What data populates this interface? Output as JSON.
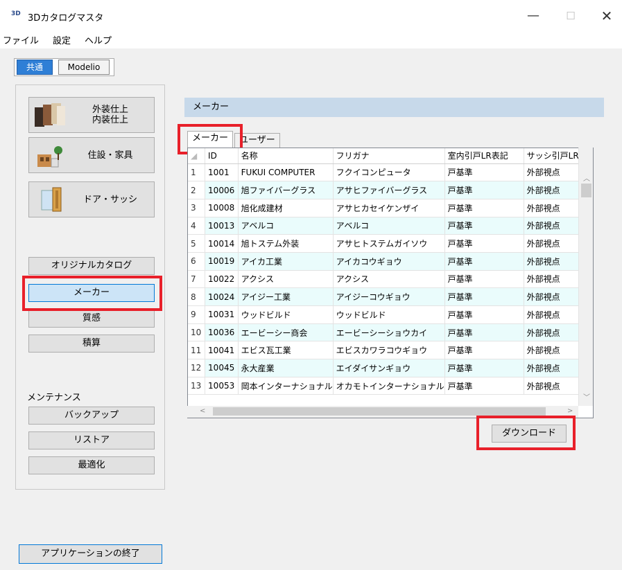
{
  "window": {
    "icon_text": "3D",
    "title": "3Dカタログマスタ",
    "min_glyph": "—",
    "max_glyph": "☐",
    "close_glyph": "✕"
  },
  "menu": [
    "ファイル",
    "設定",
    "ヘルプ"
  ],
  "top_tabs": [
    {
      "label": "共通",
      "active": true
    },
    {
      "label": "Modelio",
      "active": false
    }
  ],
  "left_panel": {
    "big_buttons": [
      {
        "line1": "外装仕上",
        "line2": "内装仕上"
      },
      {
        "line1": "住設・家具",
        "line2": ""
      },
      {
        "line1": "ドア・サッシ",
        "line2": ""
      }
    ],
    "catalog_buttons": [
      "オリジナルカタログ",
      "メーカー",
      "質感",
      "積算"
    ],
    "selected": "メーカー",
    "maintenance_label": "メンテナンス",
    "maintenance_buttons": [
      "バックアップ",
      "リストア",
      "最適化"
    ]
  },
  "content": {
    "header": "メーカー",
    "tabs": [
      "メーカー",
      "ユーザー"
    ],
    "active_tab": "メーカー",
    "columns": [
      "ID",
      "名称",
      "フリガナ",
      "室内引戸LR表記",
      "サッシ引戸LR表"
    ],
    "rows": [
      [
        "1",
        "1001",
        "FUKUI COMPUTER",
        "フクイコンピュータ",
        "戸基準",
        "外部視点"
      ],
      [
        "2",
        "10006",
        "旭ファイバーグラス",
        "アサヒファイバーグラス",
        "戸基準",
        "外部視点"
      ],
      [
        "3",
        "10008",
        "旭化成建材",
        "アサヒカセイケンザイ",
        "戸基準",
        "外部視点"
      ],
      [
        "4",
        "10013",
        "アベルコ",
        "アベルコ",
        "戸基準",
        "外部視点"
      ],
      [
        "5",
        "10014",
        "旭トステム外装",
        "アサヒトステムガイソウ",
        "戸基準",
        "外部視点"
      ],
      [
        "6",
        "10019",
        "アイカ工業",
        "アイカコウギョウ",
        "戸基準",
        "外部視点"
      ],
      [
        "7",
        "10022",
        "アクシス",
        "アクシス",
        "戸基準",
        "外部視点"
      ],
      [
        "8",
        "10024",
        "アイジー工業",
        "アイジーコウギョウ",
        "戸基準",
        "外部視点"
      ],
      [
        "9",
        "10031",
        "ウッドビルド",
        "ウッドビルド",
        "戸基準",
        "外部視点"
      ],
      [
        "10",
        "10036",
        "エービーシー商会",
        "エービーシーショウカイ",
        "戸基準",
        "外部視点"
      ],
      [
        "11",
        "10041",
        "エビス瓦工業",
        "エビスカワラコウギョウ",
        "戸基準",
        "外部視点"
      ],
      [
        "12",
        "10045",
        "永大産業",
        "エイダイサンギョウ",
        "戸基準",
        "外部視点"
      ],
      [
        "13",
        "10053",
        "岡本インターナショナル",
        "オカモトインターナショナル",
        "戸基準",
        "外部視点"
      ]
    ],
    "download_label": "ダウンロード"
  },
  "exit_label": "アプリケーションの終了",
  "colors": {
    "highlight": "#e8202a",
    "accent": "#0078d7",
    "header_bg": "#c7d9ea",
    "alt_row": "#eafcfc"
  }
}
